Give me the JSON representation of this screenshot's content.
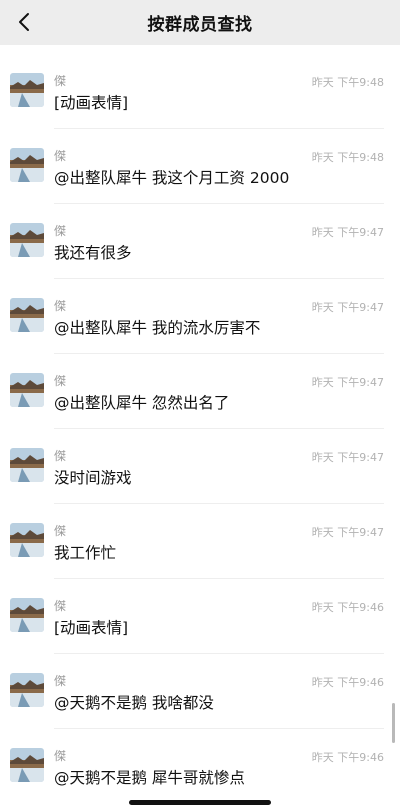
{
  "header": {
    "title": "按群成员查找",
    "back_icon": "chevron-left-icon"
  },
  "messages": [
    {
      "name": "傑",
      "time": "昨天 下午9:48",
      "text": "[动画表情]"
    },
    {
      "name": "傑",
      "time": "昨天 下午9:48",
      "text": "@出整队犀牛 我这个月工资 2000"
    },
    {
      "name": "傑",
      "time": "昨天 下午9:47",
      "text": "我还有很多"
    },
    {
      "name": "傑",
      "time": "昨天 下午9:47",
      "text": "@出整队犀牛 我的流水厉害不"
    },
    {
      "name": "傑",
      "time": "昨天 下午9:47",
      "text": "@出整队犀牛 忽然出名了"
    },
    {
      "name": "傑",
      "time": "昨天 下午9:47",
      "text": "没时间游戏"
    },
    {
      "name": "傑",
      "time": "昨天 下午9:47",
      "text": "我工作忙"
    },
    {
      "name": "傑",
      "time": "昨天 下午9:46",
      "text": "[动画表情]"
    },
    {
      "name": "傑",
      "time": "昨天 下午9:46",
      "text": "@天鹅不是鹅 我啥都没"
    },
    {
      "name": "傑",
      "time": "昨天 下午9:46",
      "text": "@天鹅不是鹅 犀牛哥就惨点"
    }
  ],
  "colors": {
    "header_bg": "#ededed",
    "text_primary": "#111111",
    "text_secondary": "#9a9a9a",
    "time_text": "#b2b2b2"
  }
}
